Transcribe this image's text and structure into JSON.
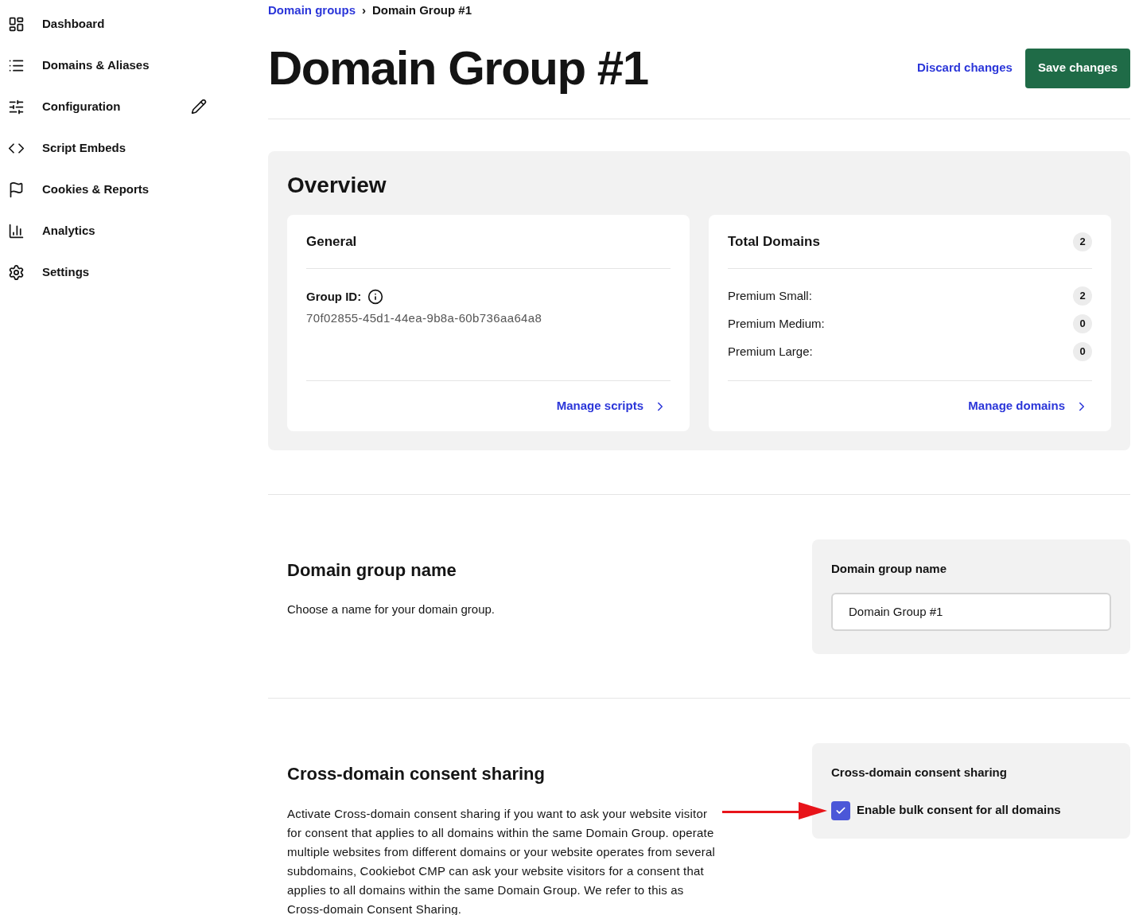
{
  "sidebar": {
    "items": [
      {
        "label": "Dashboard",
        "editing": false
      },
      {
        "label": "Domains & Aliases",
        "editing": false
      },
      {
        "label": "Configuration",
        "editing": true
      },
      {
        "label": "Script Embeds",
        "editing": false
      },
      {
        "label": "Cookies & Reports",
        "editing": false
      },
      {
        "label": "Analytics",
        "editing": false
      },
      {
        "label": "Settings",
        "editing": false
      }
    ]
  },
  "breadcrumb": {
    "link": "Domain groups",
    "separator": "›",
    "current": "Domain Group #1"
  },
  "header": {
    "title": "Domain Group #1",
    "discard": "Discard changes",
    "save": "Save changes"
  },
  "overview": {
    "title": "Overview",
    "general": {
      "title": "General",
      "id_label": "Group ID:",
      "id_value": "70f02855-45d1-44ea-9b8a-60b736aa64a8",
      "link": "Manage scripts"
    },
    "domains": {
      "title": "Total Domains",
      "count": "2",
      "rows": [
        {
          "label": "Premium Small:",
          "count": "2"
        },
        {
          "label": "Premium Medium:",
          "count": "0"
        },
        {
          "label": "Premium Large:",
          "count": "0"
        }
      ],
      "link": "Manage domains"
    }
  },
  "name_section": {
    "title": "Domain group name",
    "description": "Choose a name for your domain group.",
    "panel_title": "Domain group name",
    "value": "Domain Group #1"
  },
  "sharing_section": {
    "title": "Cross-domain consent sharing",
    "description": "Activate Cross-domain consent sharing if you want to ask your website visitor for consent that applies to all domains within the same Domain Group. operate multiple websites from different domains or your website operates from several subdomains, Cookiebot CMP can ask your website visitors for a consent that applies to all domains within the same Domain Group. We refer to this as Cross-domain Consent Sharing.",
    "panel_title": "Cross-domain consent sharing",
    "checkbox_label": "Enable bulk consent for all domains",
    "checked": true
  }
}
